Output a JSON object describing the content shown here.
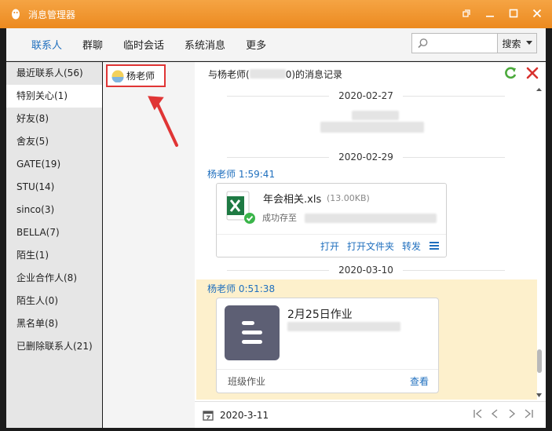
{
  "window": {
    "title": "消息管理器",
    "controls": [
      "restore-icon",
      "minimize-icon",
      "maximize-icon",
      "close-icon"
    ]
  },
  "nav": {
    "tabs": [
      "联系人",
      "群聊",
      "临时会话",
      "系统消息",
      "更多"
    ],
    "active_tab": "联系人",
    "search_placeholder": "",
    "search_button": "搜索"
  },
  "groups": [
    {
      "label": "最近联系人(56)"
    },
    {
      "label": "特别关心(1)",
      "selected": true
    },
    {
      "label": "好友(8)"
    },
    {
      "label": "舍友(5)"
    },
    {
      "label": "GATE(19)"
    },
    {
      "label": "STU(14)"
    },
    {
      "label": "sinco(3)"
    },
    {
      "label": "BELLA(7)"
    },
    {
      "label": "陌生(1)"
    },
    {
      "label": "企业合作人(8)"
    },
    {
      "label": "陌生人(0)"
    },
    {
      "label": "黑名单(8)"
    },
    {
      "label": "已删除联系人(21)"
    }
  ],
  "contact": {
    "name": "杨老师"
  },
  "messages": {
    "header_prefix": "与杨老师(",
    "header_suffix": "0)的消息记录",
    "dates": [
      "2020-02-27",
      "2020-02-29",
      "2020-03-10"
    ],
    "file_message": {
      "sender": "杨老师 1:59:41",
      "file_name": "年会相关.xls",
      "file_size": "(13.00KB)",
      "status": "成功存至",
      "actions": [
        "打开",
        "打开文件夹",
        "转发"
      ]
    },
    "homework_message": {
      "sender": "杨老师 0:51:38",
      "title": "2月25日作业",
      "category": "班级作业",
      "view_label": "查看"
    },
    "footer_date": "2020-3-11"
  },
  "colors": {
    "titlebar": "#ec8a1f",
    "accent": "#1f6fbe",
    "highlight": "#fdf0cc",
    "callout": "#e03535"
  }
}
